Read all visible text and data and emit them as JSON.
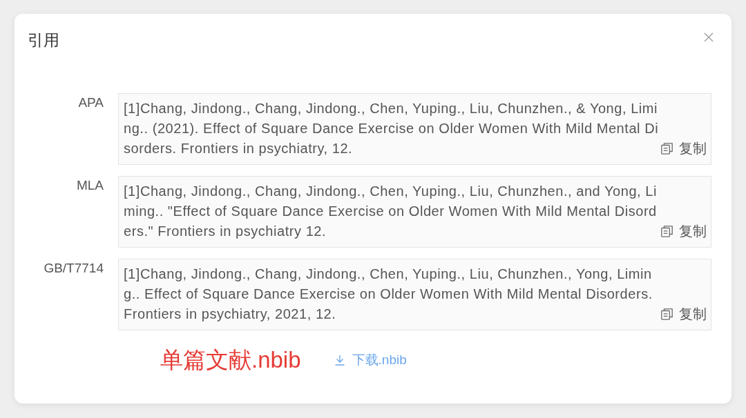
{
  "dialog": {
    "title": "引用"
  },
  "citations": [
    {
      "style": "APA",
      "text": "[1]Chang, Jindong., Chang, Jindong., Chen, Yuping., Liu, Chunzhen., & Yong, Liming.. (2021). Effect of Square Dance Exercise on Older Women With Mild Mental Disorders. Frontiers in psychiatry, 12.",
      "copy_label": "复制"
    },
    {
      "style": "MLA",
      "text": "[1]Chang, Jindong., Chang, Jindong., Chen, Yuping., Liu, Chunzhen., and Yong, Liming.. \"Effect of Square Dance Exercise on Older Women With Mild Mental Disorders.\" Frontiers in psychiatry 12.",
      "copy_label": "复制"
    },
    {
      "style": "GB/T7714",
      "text": "[1]Chang, Jindong., Chang, Jindong., Chen, Yuping., Liu, Chunzhen., Yong, Liming.. Effect of Square Dance Exercise on Older Women With Mild Mental Disorders. Frontiers in psychiatry, 2021, 12.",
      "copy_label": "复制"
    }
  ],
  "footer": {
    "annotation": "单篇文献.nbib",
    "download_label": "下载.nbib"
  }
}
